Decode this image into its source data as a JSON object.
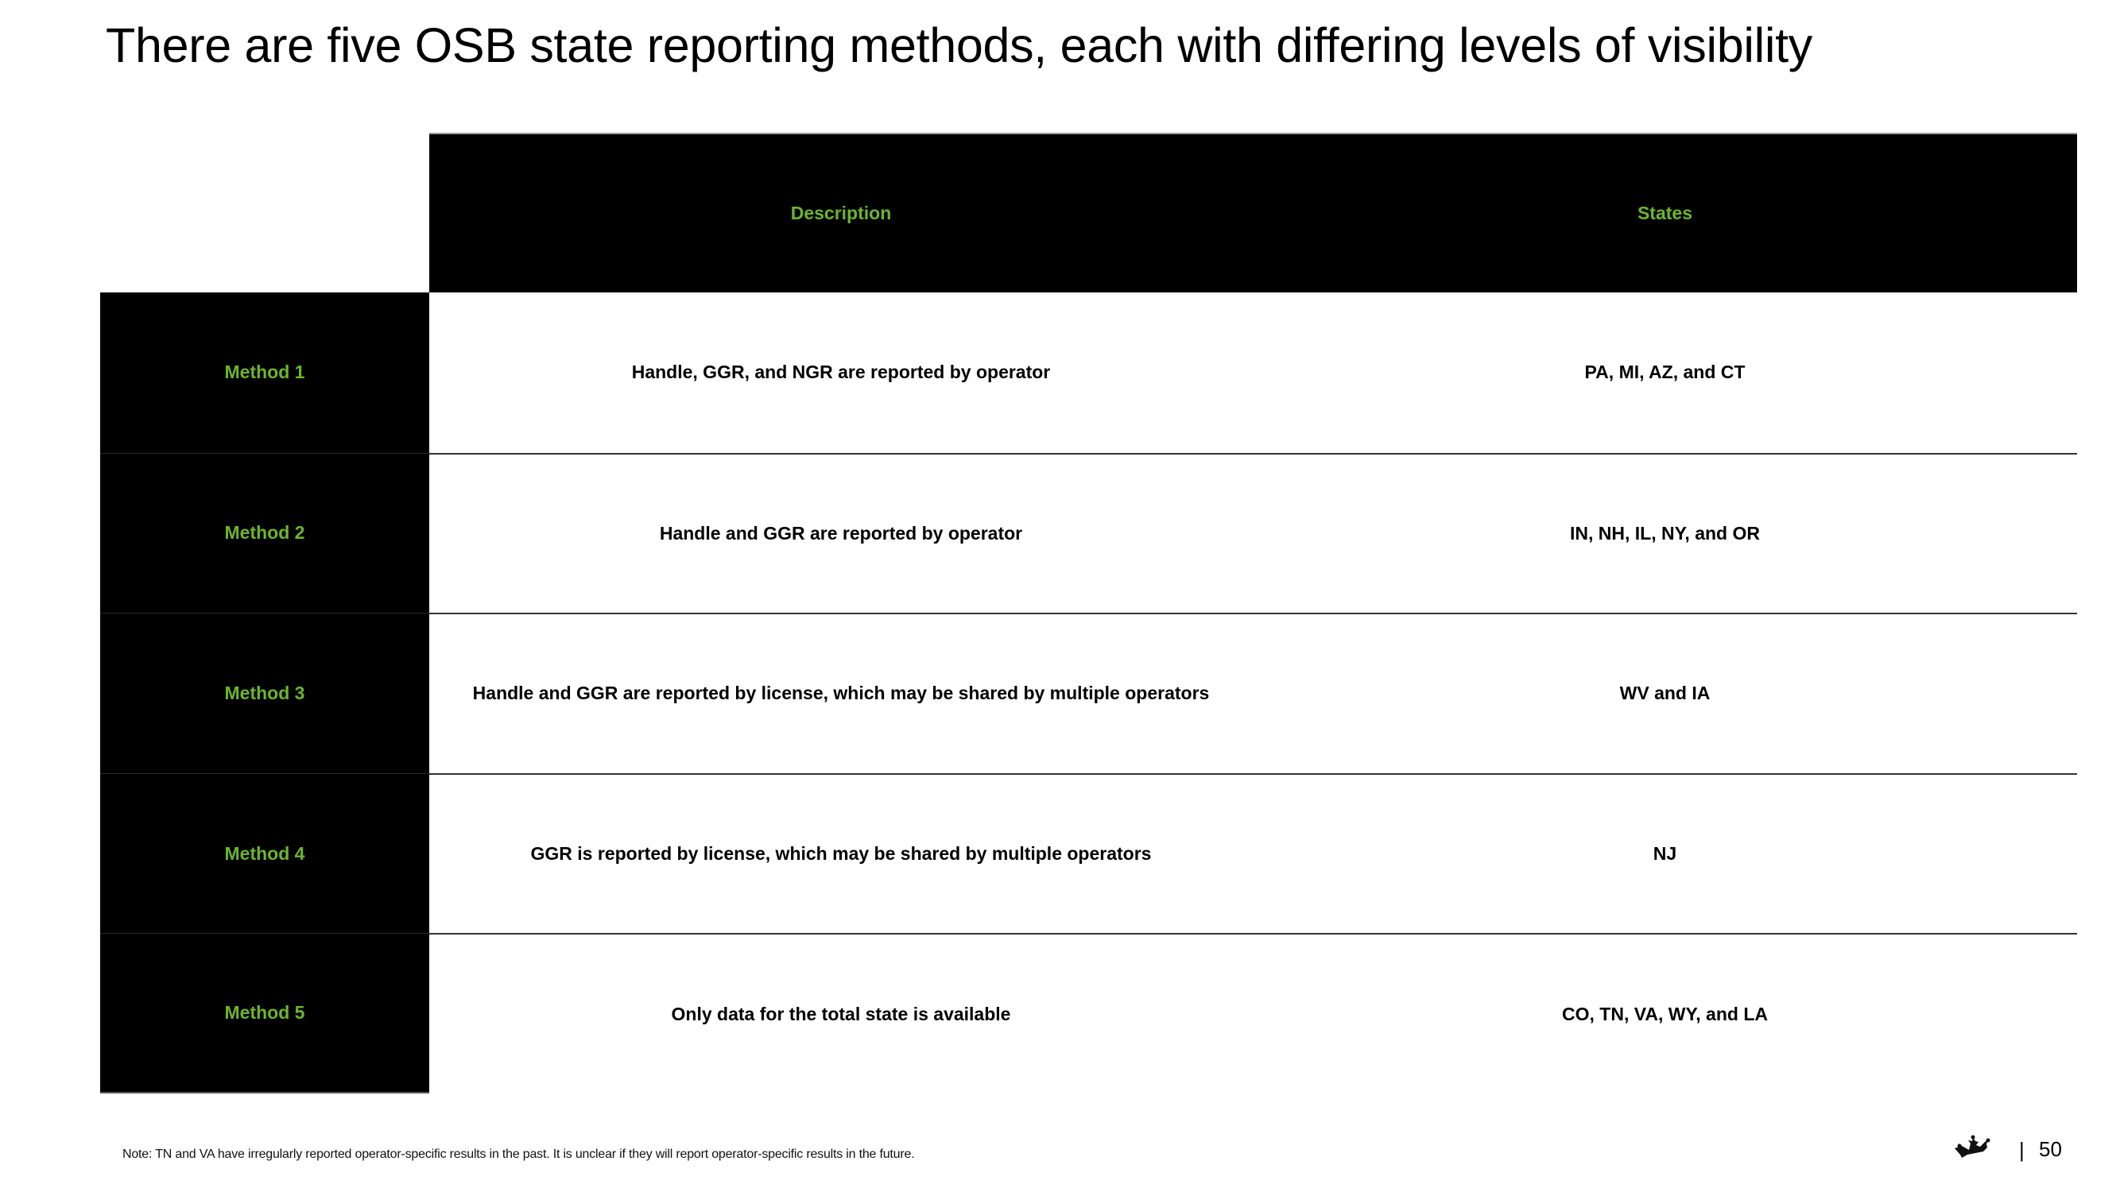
{
  "title": "There are five OSB state reporting methods, each with differing levels of visibility",
  "colors": {
    "accent_green": "#6cb52d",
    "header_bg": "#000000"
  },
  "table": {
    "headers": {
      "description": "Description",
      "states": "States"
    },
    "rows": [
      {
        "method": "Method 1",
        "description": "Handle, GGR, and NGR are reported by operator",
        "states": "PA, MI, AZ, and CT"
      },
      {
        "method": "Method 2",
        "description": "Handle and GGR are reported by operator",
        "states": "IN, NH, IL, NY, and OR"
      },
      {
        "method": "Method 3",
        "description": "Handle and GGR are reported by license, which may be shared by multiple operators",
        "states": "WV and IA"
      },
      {
        "method": "Method 4",
        "description": "GGR is reported by license, which may be shared by multiple operators",
        "states": "NJ"
      },
      {
        "method": "Method 5",
        "description": "Only data for the total state is available",
        "states": "CO, TN, VA, WY, and LA"
      }
    ]
  },
  "footer": {
    "note": "Note: TN and VA have irregularly reported operator-specific results in the past. It is unclear if they will report operator-specific results in the future.",
    "logo_icon": "crown-icon",
    "separator": "|",
    "page_number": "50"
  }
}
